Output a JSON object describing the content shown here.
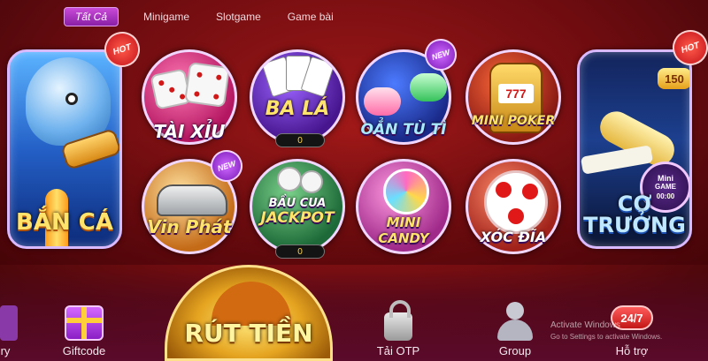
{
  "tabs": [
    {
      "label": "Tất Cả",
      "active": true
    },
    {
      "label": "Minigame",
      "active": false
    },
    {
      "label": "Slotgame",
      "active": false
    },
    {
      "label": "Game bài",
      "active": false
    }
  ],
  "games": {
    "ban_ca": {
      "title": "BẮN CÁ",
      "badge": "HOT"
    },
    "tai_xiu": {
      "title": "TÀI XỈU"
    },
    "ba_la": {
      "title": "BA LÁ",
      "counter": "0"
    },
    "oan_tu_ti": {
      "title": "OẲN TÙ TÌ",
      "badge": "NEW"
    },
    "mini_poker": {
      "title": "MINI POKER",
      "slot_text": "777"
    },
    "co_truong": {
      "title_line1": "CƠ",
      "title_line2": "TRƯỞNG",
      "badge": "HOT",
      "score": "150",
      "mini_game_line1": "Mini",
      "mini_game_line2": "GAME",
      "timer": "00:00"
    },
    "vin_phat": {
      "title": "Vin Phát",
      "badge": "NEW"
    },
    "bau_cua": {
      "title_line1": "BẦU CUA",
      "title_line2": "JACKPOT",
      "counter": "0"
    },
    "mini_candy": {
      "title_line1": "MINI",
      "title_line2": "CANDY"
    },
    "xoc_dia": {
      "title": "XÓC ĐĨA"
    }
  },
  "bottom_nav": {
    "history": {
      "label": "ry"
    },
    "giftcode": {
      "label": "Giftcode"
    },
    "withdraw": {
      "label": "RÚT TIỀN"
    },
    "otp": {
      "label": "Tải OTP"
    },
    "group": {
      "label": "Group"
    },
    "support": {
      "label": "Hỗ trợ",
      "badge": "24/7"
    }
  },
  "watermark": {
    "line1": "Activate Windows",
    "line2": "Go to Settings to activate Windows."
  },
  "colors": {
    "accent": "#8a1fa6",
    "background": "#6e0c10",
    "gold": "#ffe36b"
  }
}
